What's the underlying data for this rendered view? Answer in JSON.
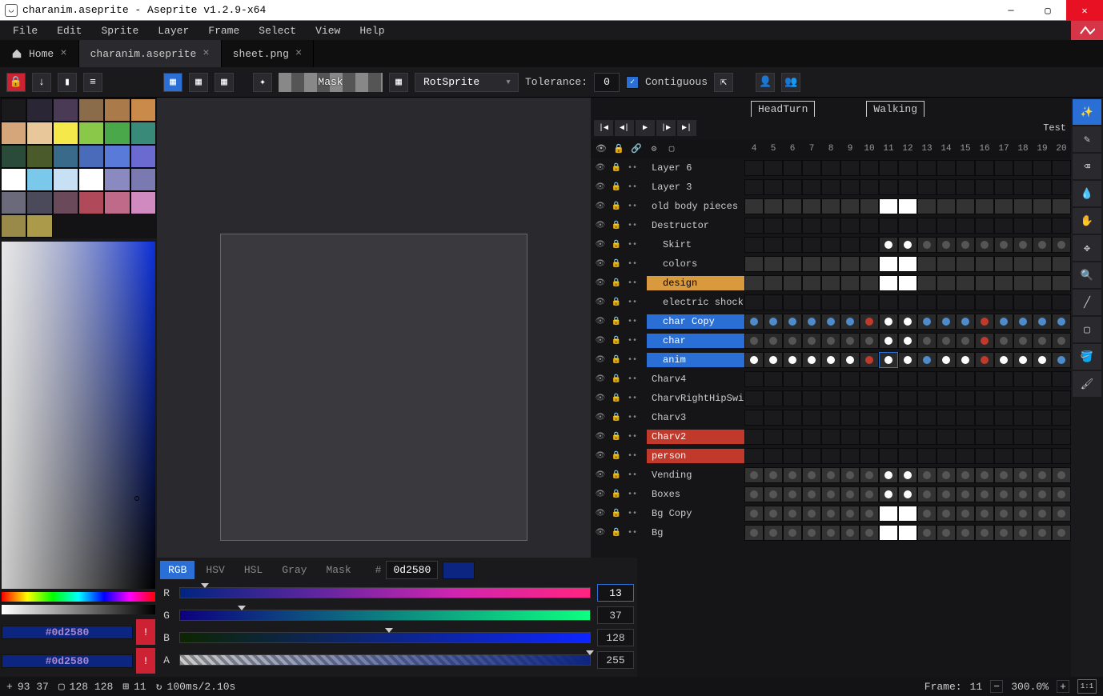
{
  "window": {
    "title": "charanim.aseprite - Aseprite v1.2.9-x64"
  },
  "menu": [
    "File",
    "Edit",
    "Sprite",
    "Layer",
    "Frame",
    "Select",
    "View",
    "Help"
  ],
  "tabs": [
    {
      "label": "Home"
    },
    {
      "label": "charanim.aseprite"
    },
    {
      "label": "sheet.png"
    }
  ],
  "toolbar": {
    "mask_label": "Mask",
    "rotation": "RotSprite",
    "tolerance_label": "Tolerance:",
    "tolerance_value": "0",
    "contiguous_label": "Contiguous"
  },
  "palette": [
    "#1a1a1c",
    "#2b2635",
    "#4a3a55",
    "#8a6b4a",
    "#aa7a4a",
    "#c98a4a",
    "#d4a67a",
    "#e8c89a",
    "#f4e84a",
    "#8ac84a",
    "#4aa84a",
    "#3a8a7a",
    "#2a4a3a",
    "#4a5a2a",
    "#3a6a8a",
    "#4a6aba",
    "#5a7ada",
    "#6a6ad0",
    "#ffffff",
    "#7ac8ea",
    "#c8e0f4",
    "#ffffff",
    "#8a8ac0",
    "#7a7ab0",
    "#6a6a7a",
    "#4a4a5a",
    "#6a4a5a",
    "#b04a5a",
    "#c06a8a",
    "#d08ac0",
    "#9a8a4a",
    "#aa9a4a"
  ],
  "color": {
    "mode_tabs": [
      "RGB",
      "HSV",
      "HSL",
      "Gray",
      "Mask"
    ],
    "hash": "#",
    "hex": "0d2580",
    "fg_label": "#0d2580",
    "bg_label": "#0d2580",
    "channels": [
      {
        "label": "R",
        "value": "13"
      },
      {
        "label": "G",
        "value": "37"
      },
      {
        "label": "B",
        "value": "128"
      },
      {
        "label": "A",
        "value": "255"
      }
    ]
  },
  "timeline": {
    "tags": [
      {
        "name": "HeadTurn"
      },
      {
        "name": "Walking"
      }
    ],
    "test_label": "Test",
    "frame_numbers": [
      "4",
      "5",
      "6",
      "7",
      "8",
      "9",
      "10",
      "11",
      "12",
      "13",
      "14",
      "15",
      "16",
      "17",
      "18",
      "19",
      "20"
    ],
    "layers": [
      {
        "name": "Layer 6",
        "style": ""
      },
      {
        "name": "Layer 3",
        "style": ""
      },
      {
        "name": "old body pieces",
        "style": "",
        "locked": true
      },
      {
        "name": "Destructor",
        "style": ""
      },
      {
        "name": "Skirt",
        "style": "",
        "indent": true
      },
      {
        "name": "colors",
        "style": "",
        "indent": true
      },
      {
        "name": "design",
        "style": "orange",
        "indent": true
      },
      {
        "name": "electric shock",
        "style": "",
        "indent": true
      },
      {
        "name": "char Copy",
        "style": "blue",
        "indent": true
      },
      {
        "name": "char",
        "style": "blue",
        "indent": true
      },
      {
        "name": "anim",
        "style": "blue",
        "indent": true
      },
      {
        "name": "Charv4",
        "style": ""
      },
      {
        "name": "CharvRightHipSwing",
        "style": ""
      },
      {
        "name": "Charv3",
        "style": "",
        "locked": true
      },
      {
        "name": "Charv2",
        "style": "red"
      },
      {
        "name": "person",
        "style": "red"
      },
      {
        "name": "Vending",
        "style": ""
      },
      {
        "name": "Boxes",
        "style": ""
      },
      {
        "name": "Bg Copy",
        "style": ""
      },
      {
        "name": "Bg",
        "style": ""
      }
    ]
  },
  "status": {
    "cursor": "93 37",
    "size": "128 128",
    "frames_icon": "11",
    "timing": "100ms/2.10s",
    "frame_label": "Frame:",
    "frame_value": "11",
    "zoom": "300.0%"
  }
}
